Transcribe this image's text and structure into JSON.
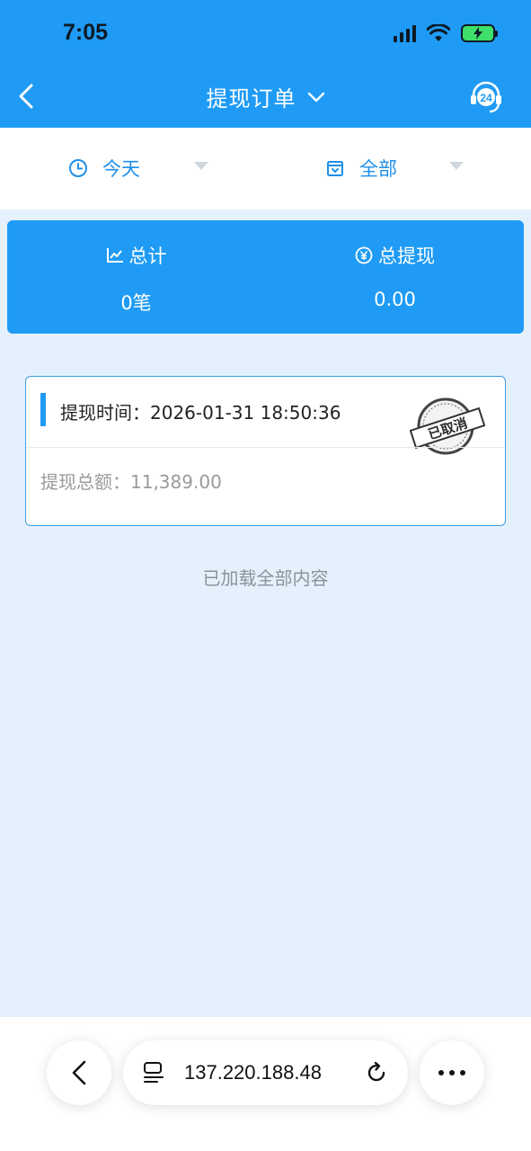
{
  "status_bar": {
    "time": "7:05"
  },
  "header": {
    "title": "提现订单",
    "support_badge": "24"
  },
  "filters": {
    "date": {
      "label": "今天",
      "icon": "clock-icon"
    },
    "type": {
      "label": "全部",
      "icon": "calendar-box-icon"
    }
  },
  "summary": {
    "total_label": "总计",
    "total_value": "0笔",
    "withdraw_label": "总提现",
    "withdraw_value": "0.00"
  },
  "orders": [
    {
      "time_label": "提现时间：",
      "time_value": "2026-01-31 18:50:36",
      "amount_label": "提现总额：",
      "amount_value": "11,389.00",
      "stamp_text": "已取消"
    }
  ],
  "list_footer": "已加载全部内容",
  "browser": {
    "url": "137.220.188.48"
  },
  "colors": {
    "primary": "#1f9bf5",
    "page_bg": "#e4f1fc",
    "filter_text": "#1f8fe8"
  }
}
